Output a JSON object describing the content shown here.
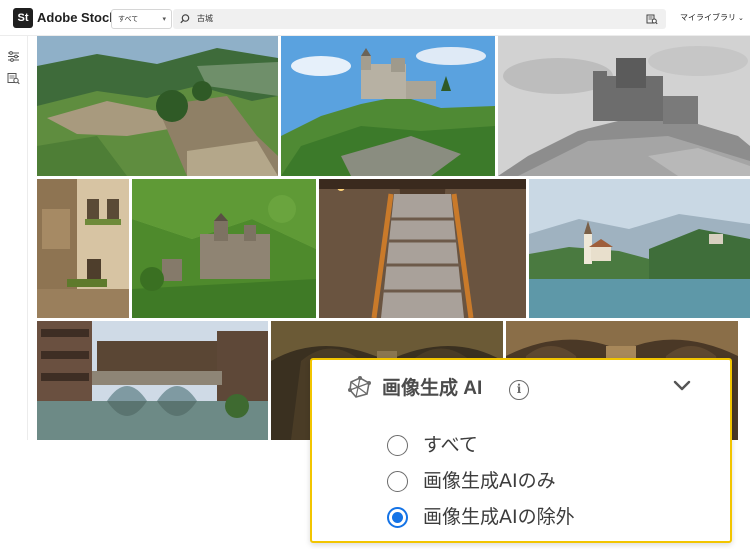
{
  "header": {
    "logo_badge": "St",
    "logo_text": "Adobe Stock",
    "filter_select": "すべて",
    "search_query": "古城",
    "my_library": "マイライブラリ"
  },
  "left_rail": {
    "icons": [
      "filter-sliders-icon",
      "visual-search-icon"
    ]
  },
  "results": {
    "images": [
      {
        "subject": "castle-ruins-hillside"
      },
      {
        "subject": "castle-on-green-hill"
      },
      {
        "subject": "castle-monochrome-hill"
      },
      {
        "subject": "old-stone-town-facade"
      },
      {
        "subject": "castle-in-forest"
      },
      {
        "subject": "wooden-staircase-interior"
      },
      {
        "subject": "lake-island-church"
      },
      {
        "subject": "ancient-town-bridge-river"
      },
      {
        "subject": "gothic-vaulted-hall"
      },
      {
        "subject": "cathedral-arches"
      }
    ]
  },
  "ai_filter": {
    "title": "画像生成 AI",
    "info_glyph": "i",
    "expanded": true,
    "options": [
      {
        "label": "すべて",
        "selected": false
      },
      {
        "label": "画像生成AIのみ",
        "selected": false
      },
      {
        "label": "画像生成AIの除外",
        "selected": true
      }
    ]
  },
  "colors": {
    "highlight_border": "#f2c500",
    "radio_selected": "#1473e6",
    "logo_bg": "#1f1f1f"
  }
}
